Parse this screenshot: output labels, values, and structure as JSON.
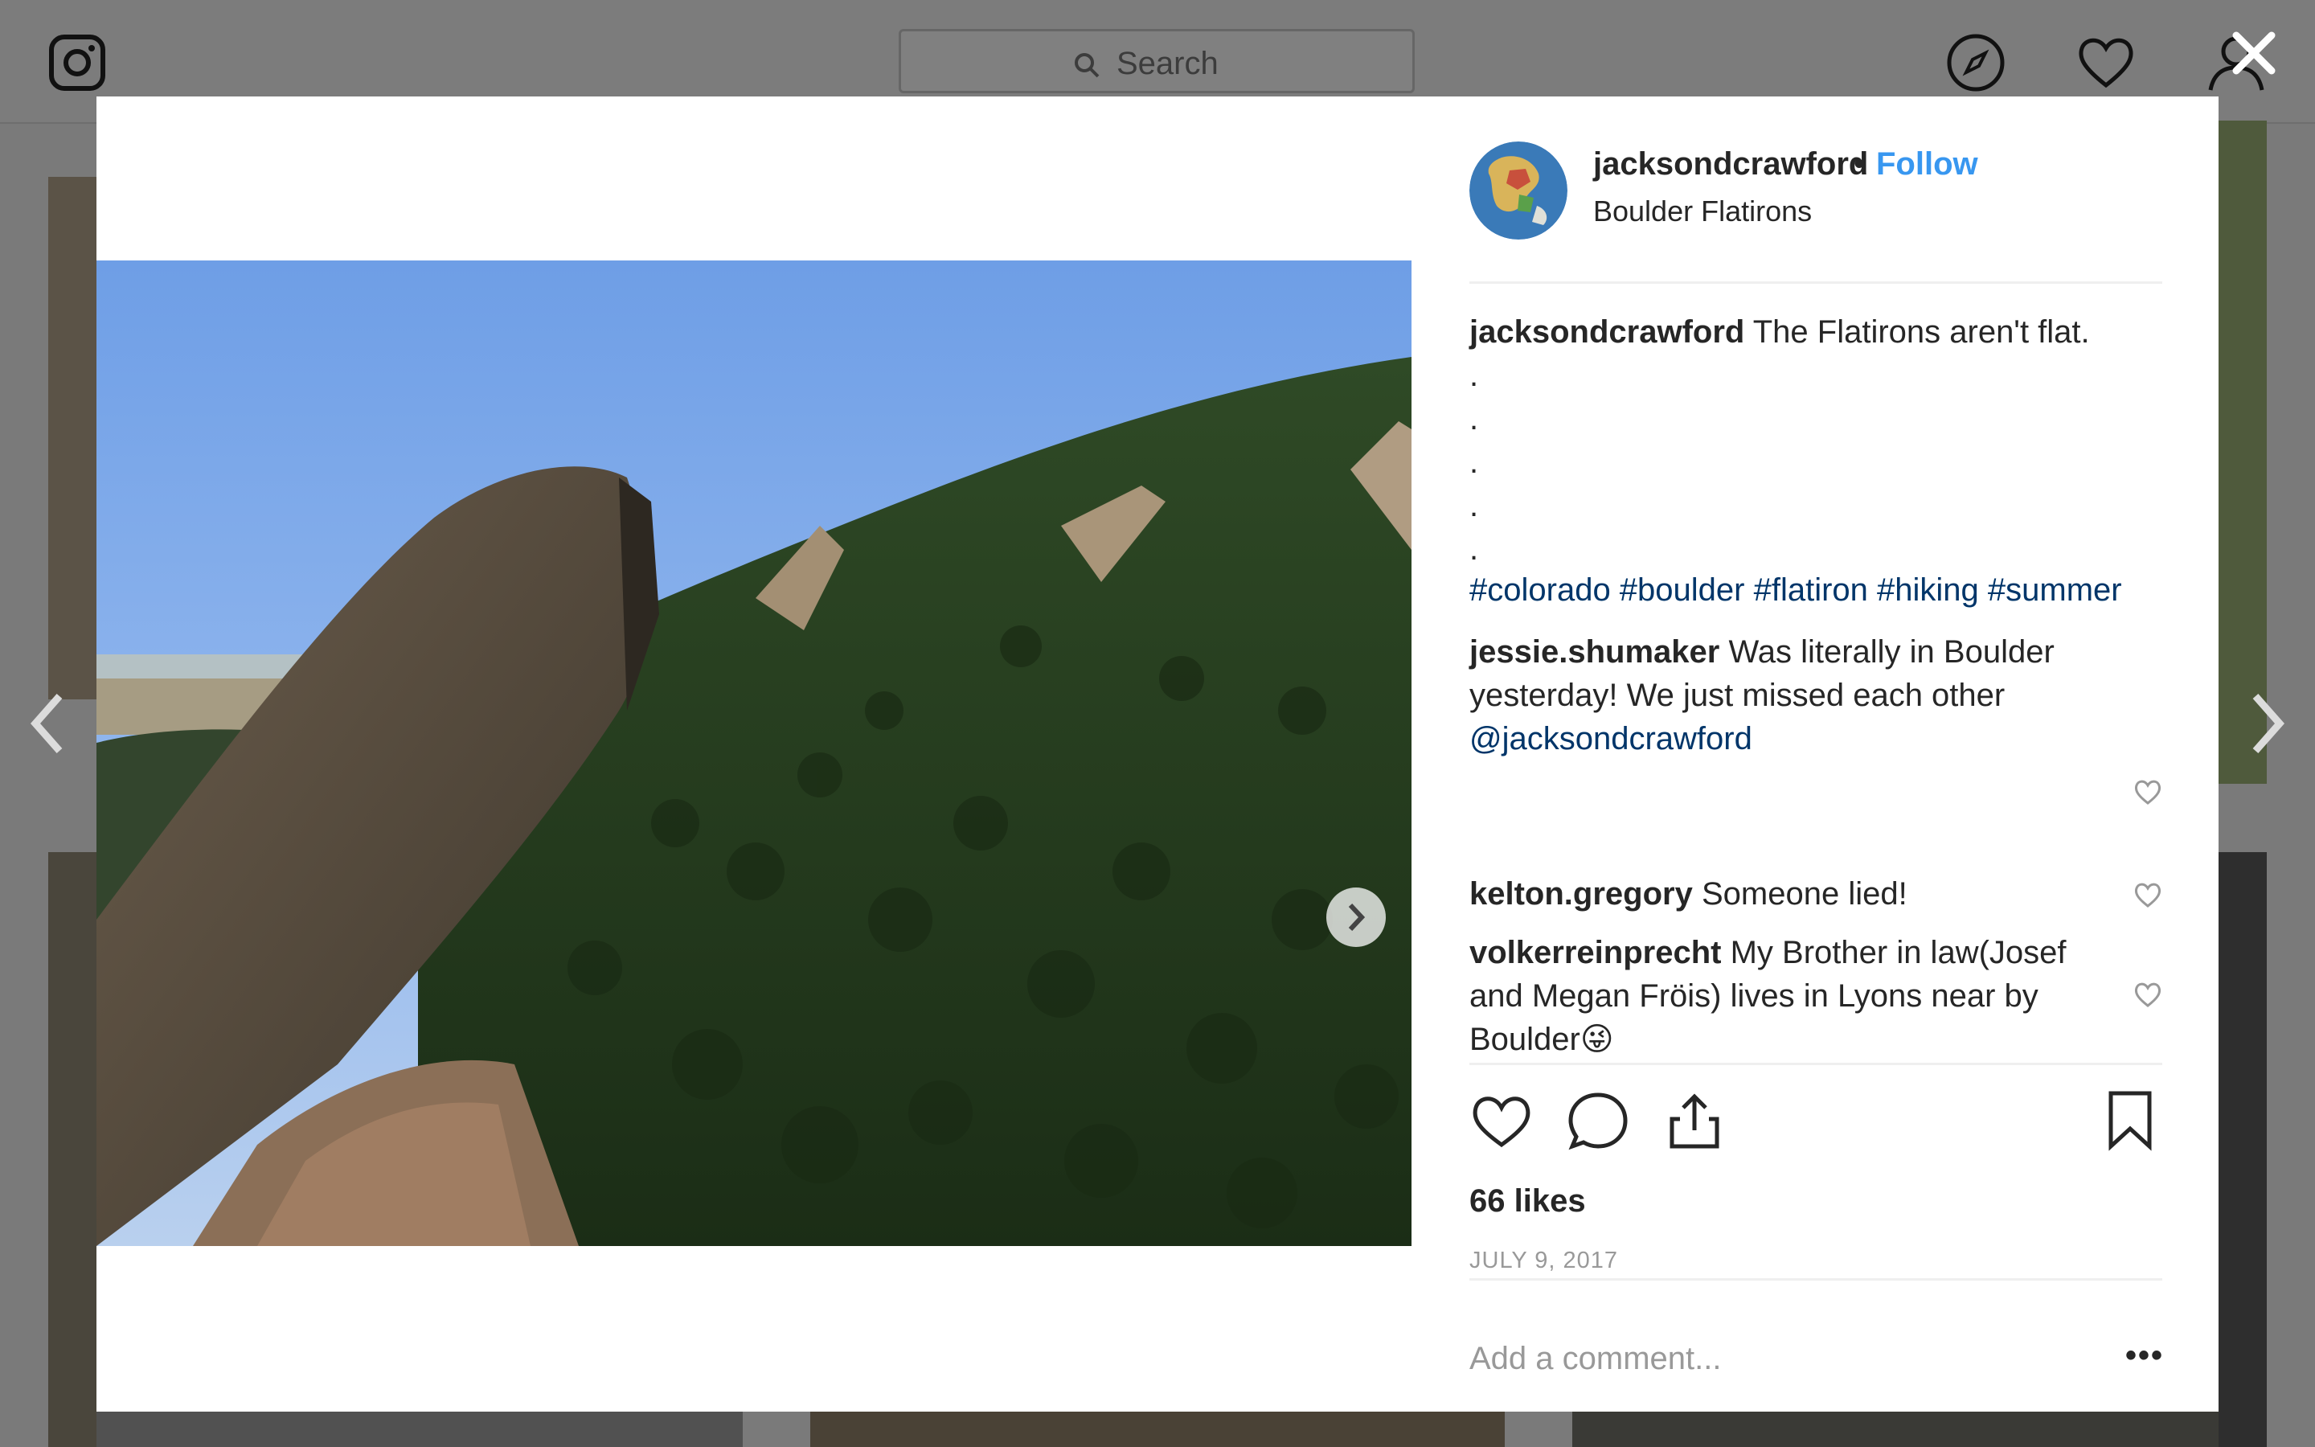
{
  "background": {
    "search_placeholder": "Search",
    "icons": [
      "instagram-logo",
      "search-icon",
      "explore-compass",
      "activity-heart",
      "profile-person"
    ]
  },
  "post": {
    "username": "jacksondcrawford",
    "separator": "•",
    "follow_label": "Follow",
    "location": "Boulder Flatirons",
    "caption_text": "The Flatirons aren't flat.",
    "caption_dots": [
      ".",
      ".",
      ".",
      ".",
      "."
    ],
    "hashtags": "#colorado #boulder #flatiron #hiking #summer",
    "comments": [
      {
        "user": "jessie.shumaker",
        "text": "Was literally in Boulder yesterday! We just missed each other ",
        "mention": "@jacksondcrawford"
      },
      {
        "user": "kelton.gregory",
        "text": "Someone lied!"
      },
      {
        "user": "volkerreinprecht",
        "text": "My Brother in law(Josef and Megan Fröis) lives in Lyons near by Boulder😜"
      }
    ],
    "likes": "66 likes",
    "date": "JULY 9, 2017",
    "add_comment_placeholder": "Add a comment...",
    "more_label": "•••"
  },
  "colors": {
    "link_blue": "#3897f0",
    "hashtag_navy": "#003569",
    "text": "#262626",
    "muted": "#999999",
    "overlay": "#7a7a7a"
  }
}
